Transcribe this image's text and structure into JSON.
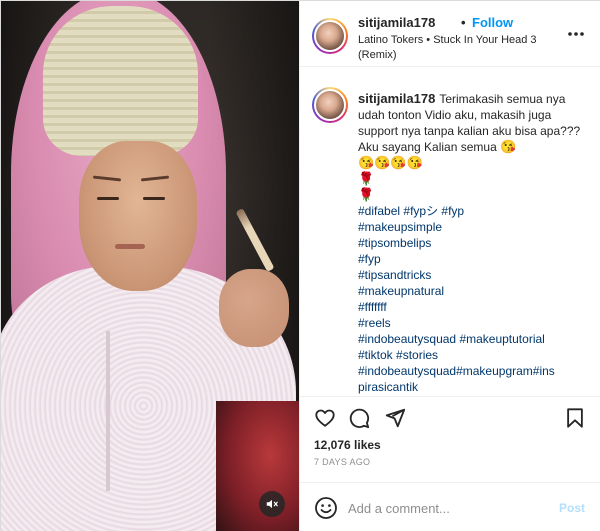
{
  "post": {
    "username": "sitijamila178",
    "follow_label": "Follow",
    "dot": "•",
    "audio": "Latino Tokers • Stuck In Your Head 3 (Remix)",
    "caption": "Terimakasih semua nya udah tonton Vidio aku, makasih juga support nya tanpa kalian aku bisa apa??? Aku sayang Kalian semua",
    "caption_emoji_1": "😘",
    "caption_emoji_2": "😘😘😘😘",
    "rose_1": "🌹",
    "rose_2": "🌹",
    "tags": {
      "t1": "#difabel",
      "t2": "#fypシ",
      "t3": "#fyp",
      "t4": "#makeupsimple",
      "t5": "#tipsombelips",
      "t6": "#fyp",
      "t7": "#tipsandtricks",
      "t8": "#makeupnatural",
      "t9": "#fffffff",
      "t10": "#reels",
      "t11": "#indobeautysquad",
      "t12": "#makeuptutorial",
      "t13": "#tiktok",
      "t14": "#stories",
      "t15": "#indobeautysquad#makeupgram#ins",
      "t16": "pirasicantik"
    },
    "likes": "12,076 likes",
    "date": "7 DAYS AGO",
    "comment_placeholder": "Add a comment...",
    "post_label": "Post"
  },
  "icons": {
    "more": "more-options-icon",
    "like": "heart-icon",
    "comment": "comment-icon",
    "share": "share-icon",
    "save": "bookmark-icon",
    "emoji": "emoji-icon",
    "mute": "muted-audio-icon"
  },
  "colors": {
    "link": "#0095f6",
    "hashtag": "#00376b",
    "muted_text": "#8e8e8e",
    "post_disabled": "#b2dffc"
  }
}
